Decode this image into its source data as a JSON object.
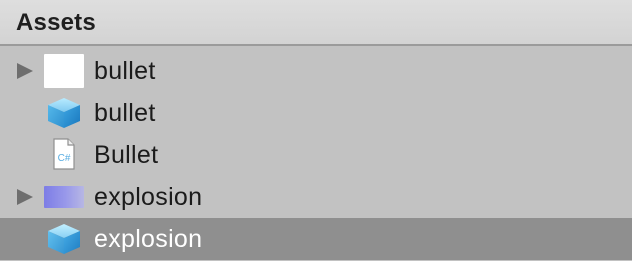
{
  "panel": {
    "title": "Assets"
  },
  "items": [
    {
      "name": "bullet",
      "type": "texture",
      "expandable": true,
      "selected": false
    },
    {
      "name": "bullet",
      "type": "prefab",
      "expandable": false,
      "selected": false
    },
    {
      "name": "Bullet",
      "type": "script",
      "icon_text": "C#",
      "expandable": false,
      "selected": false
    },
    {
      "name": "explosion",
      "type": "texture",
      "expandable": true,
      "selected": false
    },
    {
      "name": "explosion",
      "type": "prefab",
      "expandable": false,
      "selected": true
    }
  ],
  "colors": {
    "background": "#c2c2c2",
    "header": "#d8d8d8",
    "selected_row": "#8f8f8f",
    "prefab_blue": "#5aaee2",
    "texture_purple": "#8f8fe8"
  }
}
